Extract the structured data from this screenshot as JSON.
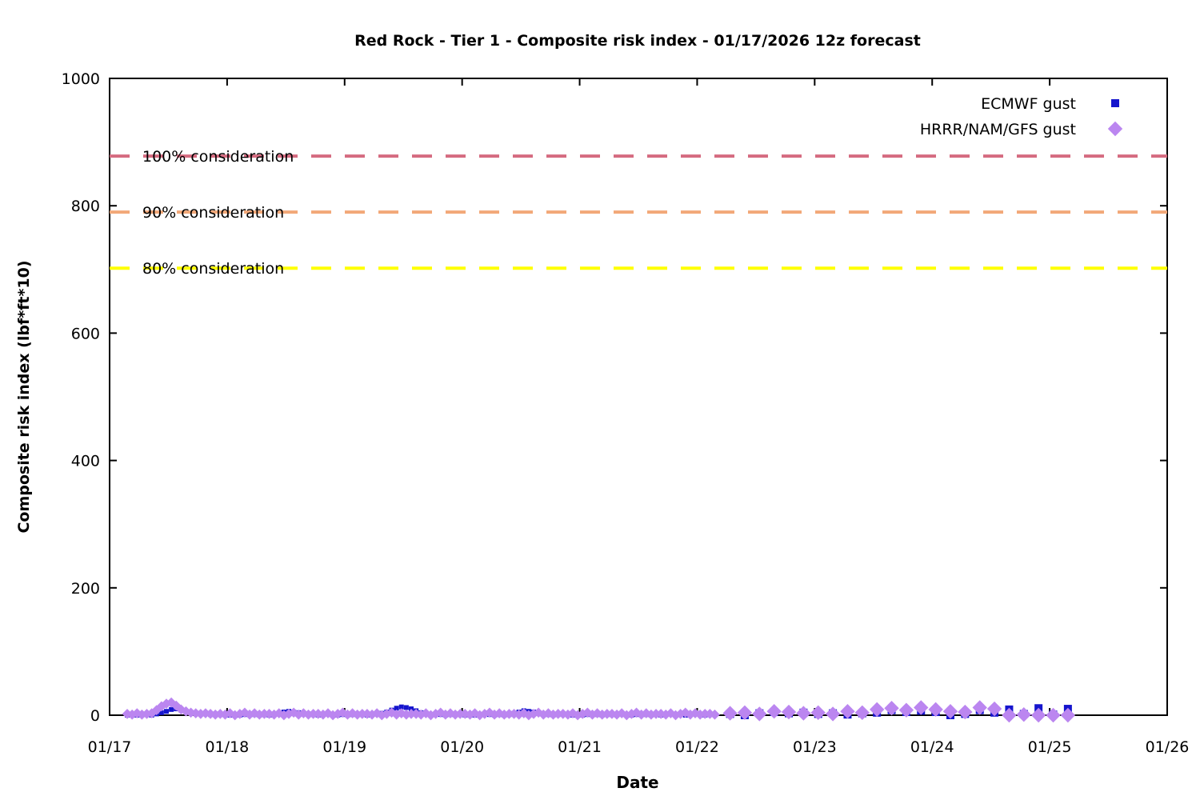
{
  "page": {
    "background": "#ffffff"
  },
  "chart_data": {
    "type": "scatter",
    "title": "Red Rock - Tier 1 - Composite risk index - 01/17/2026 12z forecast",
    "xlabel": "Date",
    "ylabel": "Composite risk index (lbf*ft*10)",
    "ylim": [
      0,
      1000
    ],
    "yticks": [
      0,
      200,
      400,
      600,
      800,
      1000
    ],
    "x_axis_days_range": [
      0,
      9
    ],
    "x_units": "days since 01/17 00z; point x = start_day + index * step_days",
    "xticks_days": [
      0,
      1,
      2,
      3,
      4,
      5,
      6,
      7,
      8,
      9
    ],
    "xtick_labels": [
      "01/17",
      "01/18",
      "01/19",
      "01/20",
      "01/21",
      "01/22",
      "01/23",
      "01/24",
      "01/25",
      "01/26"
    ],
    "grid": false,
    "legend_position": "top-right-inside",
    "thresholds": [
      {
        "label": "100% consideration",
        "value": 878,
        "color": "#d56b80"
      },
      {
        "label": "90% consideration",
        "value": 790,
        "color": "#f2a878"
      },
      {
        "label": "80% consideration",
        "value": 702,
        "color": "#ffff00"
      }
    ],
    "series": [
      {
        "name": "ECMWF gust",
        "color": "#1515cd",
        "marker": "square",
        "segments": [
          {
            "start_day": 0.15,
            "step_days": 0.0416667,
            "marker_size": 6,
            "values": [
              0,
              1,
              0,
              2,
              1,
              0,
              2,
              4,
              6,
              9,
              10,
              8,
              6,
              4,
              3,
              2,
              2,
              1,
              2,
              1,
              1,
              0,
              1,
              0,
              1,
              2,
              1,
              0,
              1,
              0,
              2,
              3,
              5,
              6,
              5,
              4,
              3,
              2,
              1,
              0,
              1,
              2,
              1,
              0,
              1,
              0,
              1,
              2,
              1,
              0,
              1,
              2,
              3,
              5,
              8,
              11,
              13,
              12,
              10,
              7,
              4,
              2,
              1,
              2,
              1,
              0,
              1,
              2,
              1,
              0,
              1,
              0,
              1,
              2,
              1,
              0,
              1,
              0,
              1,
              3,
              5,
              7,
              6,
              5,
              3,
              2,
              1,
              0,
              1,
              2,
              1,
              0,
              1,
              0,
              1,
              2,
              1,
              0,
              1,
              1,
              0,
              2,
              1,
              0,
              1,
              2,
              1,
              0,
              1,
              0,
              1,
              2,
              1,
              2,
              0,
              1,
              2,
              1,
              0,
              1,
              1
            ]
          },
          {
            "start_day": 5.28,
            "step_days": 0.125,
            "marker_size": 10,
            "values": [
              2,
              0,
              3,
              5,
              3,
              4,
              2,
              3,
              1,
              3,
              4,
              8,
              5,
              7,
              5,
              0,
              2,
              8,
              4,
              9,
              2,
              11,
              1,
              10
            ]
          }
        ]
      },
      {
        "name": "HRRR/NAM/GFS gust",
        "color": "#bb86f0",
        "marker": "diamond",
        "segments": [
          {
            "start_day": 0.15,
            "step_days": 0.0416667,
            "marker_size": 9,
            "values": [
              2,
              1,
              3,
              1,
              2,
              3,
              8,
              14,
              18,
              20,
              15,
              9,
              6,
              4,
              3,
              2,
              3,
              2,
              1,
              2,
              1,
              3,
              0,
              2,
              4,
              1,
              3,
              1,
              2,
              2,
              1,
              3,
              0,
              2,
              4,
              1,
              3,
              1,
              2,
              2,
              1,
              3,
              0,
              2,
              4,
              1,
              3,
              1,
              2,
              2,
              1,
              3,
              0,
              2,
              4,
              1,
              3,
              1,
              2,
              2,
              1,
              3,
              0,
              2,
              4,
              1,
              3,
              1,
              2,
              2,
              1,
              3,
              0,
              2,
              4,
              1,
              3,
              1,
              2,
              2,
              1,
              3,
              0,
              2,
              4,
              1,
              3,
              1,
              2,
              2,
              1,
              3,
              0,
              2,
              4,
              1,
              3,
              1,
              2,
              2,
              1,
              3,
              0,
              2,
              4,
              1,
              3,
              1,
              2,
              2,
              1,
              3,
              0,
              2,
              4,
              1,
              3,
              1,
              2,
              2,
              1
            ]
          },
          {
            "start_day": 5.28,
            "step_days": 0.125,
            "marker_size": 13,
            "values": [
              3,
              4,
              2,
              6,
              5,
              3,
              4,
              2,
              6,
              4,
              9,
              11,
              8,
              12,
              9,
              6,
              5,
              12,
              10,
              0,
              1,
              0,
              0,
              0
            ]
          }
        ]
      }
    ]
  }
}
